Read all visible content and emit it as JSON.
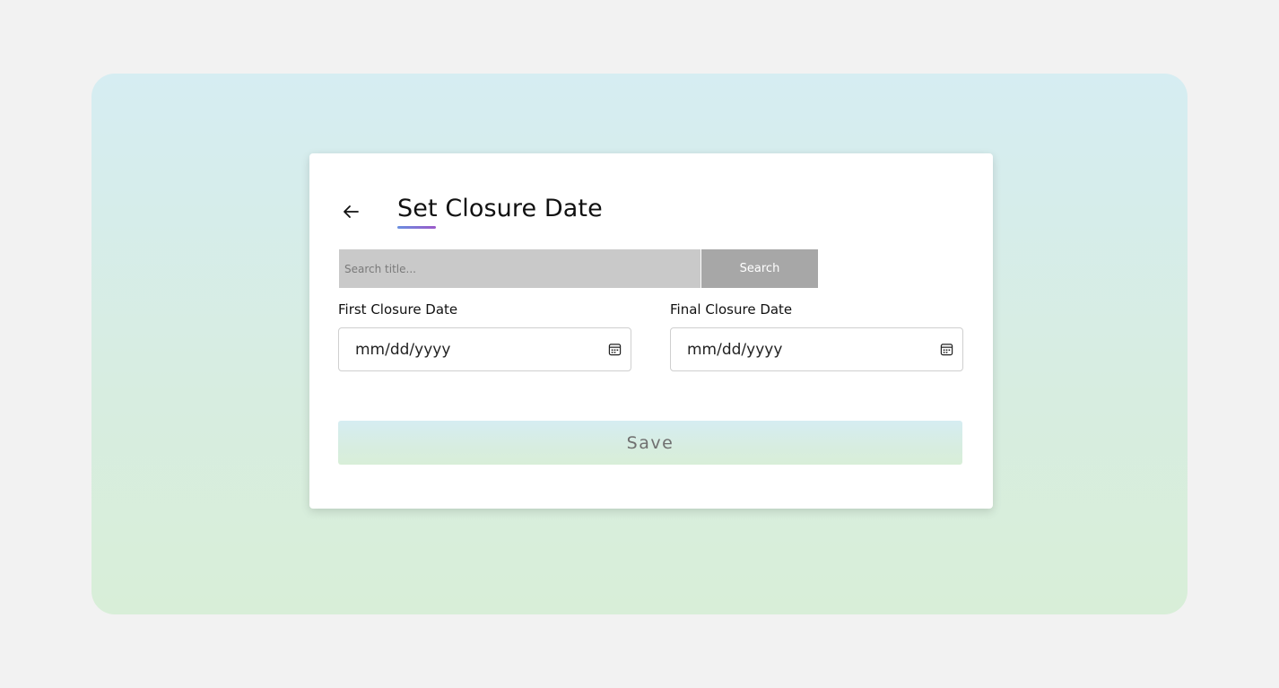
{
  "page": {
    "title": "Set Closure Date"
  },
  "search": {
    "placeholder": "Search title...",
    "value": "",
    "button_label": "Search"
  },
  "fields": {
    "first": {
      "label": "First Closure Date",
      "value": "mm/dd/yyyy"
    },
    "final": {
      "label": "Final Closure Date",
      "value": "mm/dd/yyyy"
    }
  },
  "actions": {
    "save_label": "Save"
  },
  "icons": {
    "back": "arrow-left-icon",
    "calendar": "calendar-icon"
  },
  "colors": {
    "page_background": "#f2f2f2",
    "backdrop_top": "#d6edf2",
    "backdrop_bottom": "#d8eed8",
    "search_input": "#c9c9c9",
    "search_button": "#a7a7a7",
    "underline_start": "#6a8fe0",
    "underline_end": "#9b59c9"
  }
}
